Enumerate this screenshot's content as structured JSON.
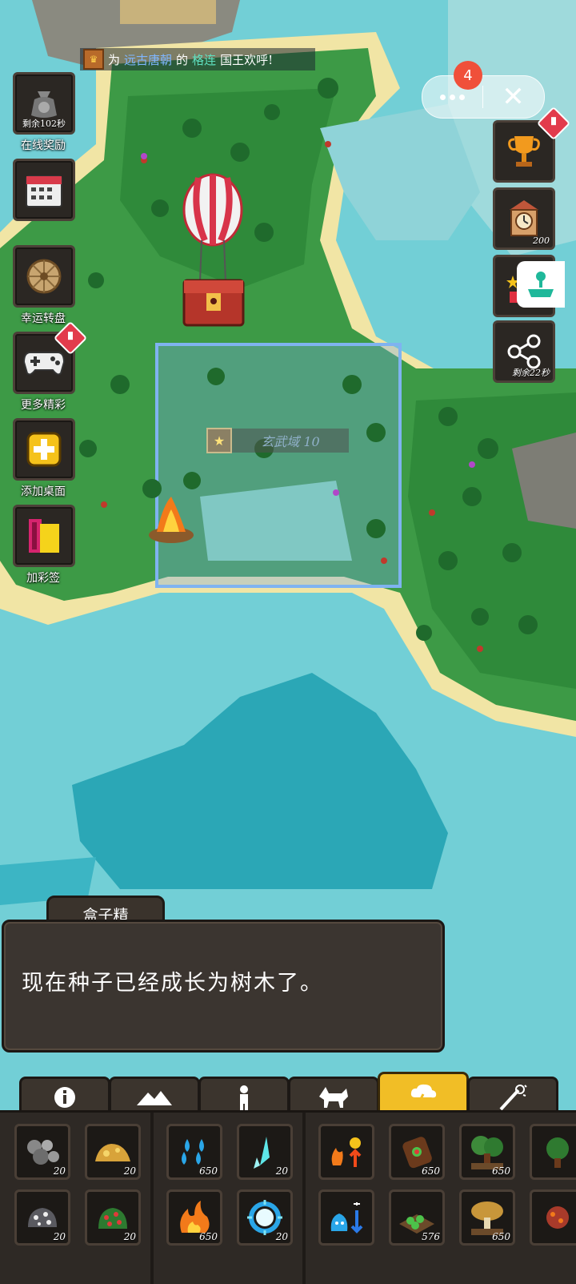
{
  "notice": {
    "prefix": "为",
    "dynasty": "远古唐朝",
    "mid": "的",
    "king": "格连",
    "suffix": "国王欢呼!"
  },
  "left_buttons": [
    {
      "id": "online-reward",
      "label": "在线奖励",
      "timer": "剩余102秒"
    },
    {
      "id": "calendar",
      "label": ""
    },
    {
      "id": "lucky-wheel",
      "label": "幸运转盘"
    },
    {
      "id": "more-fun",
      "label": "更多精彩"
    },
    {
      "id": "add-desktop",
      "label": "添加桌面"
    },
    {
      "id": "add-tag",
      "label": "加彩签"
    }
  ],
  "right_buttons": [
    {
      "id": "trophy",
      "count": ""
    },
    {
      "id": "clock",
      "count": "200"
    },
    {
      "id": "share",
      "count": "剩余22秒"
    }
  ],
  "capsule": {
    "notification_count": "4"
  },
  "zone": {
    "name": "玄武域 10"
  },
  "dialog": {
    "speaker": "盒子精",
    "text": "现在种子已经成长为树木了。"
  },
  "tabs": [
    "info",
    "terrain",
    "humanoid",
    "animal",
    "weather",
    "magic"
  ],
  "active_tab": "weather",
  "inventory": [
    {
      "icon": "stone-ore-icon",
      "count": "20"
    },
    {
      "icon": "gold-ore-icon",
      "count": "20"
    },
    {
      "icon": "water-drops-icon",
      "count": "650"
    },
    {
      "icon": "ice-crystal-icon",
      "count": "20"
    },
    {
      "icon": "heat-up-icon",
      "count": ""
    },
    {
      "icon": "seed-bag-icon",
      "count": "650"
    },
    {
      "icon": "tree-sapling-icon",
      "count": "650"
    },
    {
      "icon": "bush-icon",
      "count": ""
    },
    {
      "icon": "silver-ore-icon",
      "count": "20"
    },
    {
      "icon": "berry-bush-icon",
      "count": "20"
    },
    {
      "icon": "fire-icon",
      "count": "650"
    },
    {
      "icon": "frost-orb-icon",
      "count": "20"
    },
    {
      "icon": "cool-down-icon",
      "count": ""
    },
    {
      "icon": "farm-plot-icon",
      "count": "576"
    },
    {
      "icon": "mushroom-tree-icon",
      "count": "650"
    },
    {
      "icon": "lava-icon",
      "count": ""
    }
  ],
  "colors": {
    "active_tab": "#f1be26",
    "panel": "#2e2925",
    "badge": "#e23b4c"
  }
}
